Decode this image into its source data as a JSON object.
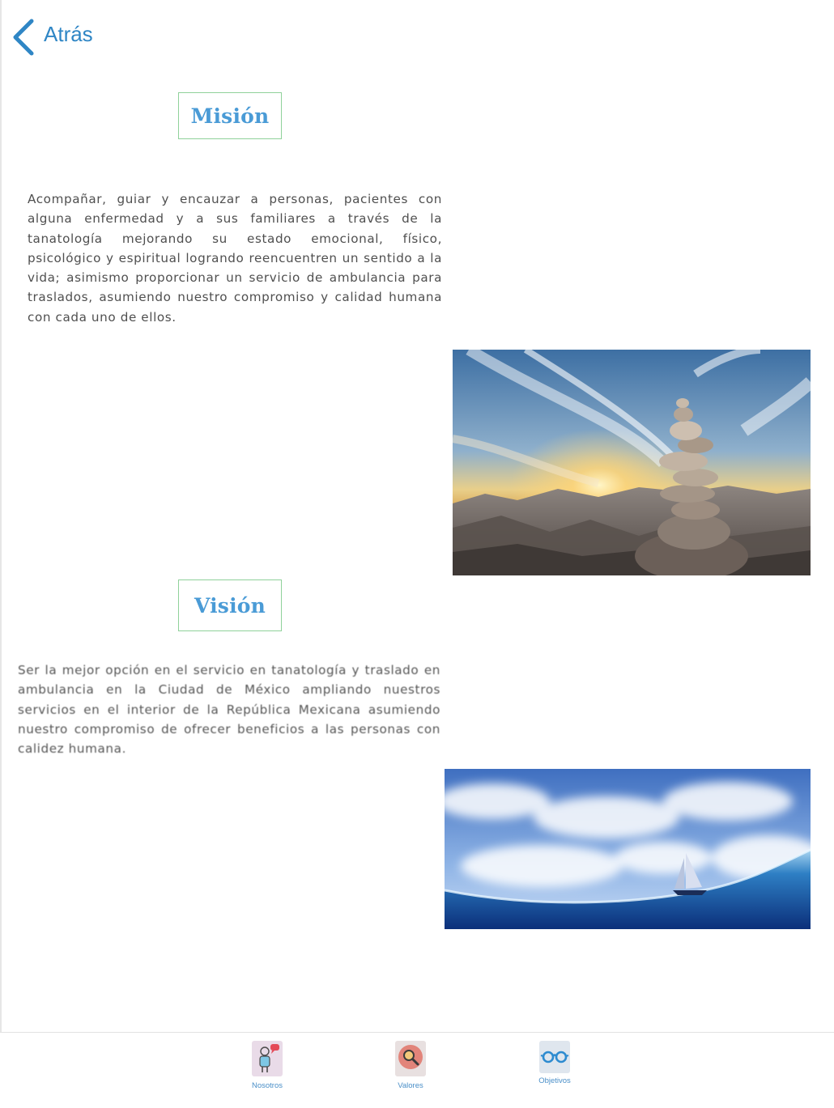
{
  "header": {
    "back_label": "Atrás"
  },
  "mision": {
    "title": "Misión",
    "text": "Acompañar, guiar y encauzar a personas, pacientes con alguna enfermedad y a sus familiares a través de la tanatología mejorando su estado emocional, físico, psicológico y espiritual logrando reencuentren un sentido a la vida; asimismo proporcionar un servicio de ambulancia para traslados, asumiendo nuestro compromiso y calidad humana con cada uno de ellos.",
    "image": "stacked-stones-sunset-image"
  },
  "vision": {
    "title": "Visión",
    "text": "Ser la mejor opción en el servicio en tanatología y traslado en ambulancia en la Ciudad de México ampliando nuestros servicios en el interior de la República Mexicana asumiendo nuestro compromiso de ofrecer beneficios a las personas con calidez humana.",
    "image": "sailboat-sky-wave-image"
  },
  "tabbar": {
    "tabs": [
      {
        "label": "Nosotros",
        "icon": "people-chat-icon"
      },
      {
        "label": "Valores",
        "icon": "magnifier-badge-icon"
      },
      {
        "label": "Objetivos",
        "icon": "glasses-icon"
      }
    ]
  },
  "colors": {
    "accent_blue": "#2f86c5",
    "heading_blue": "#4a9bd6",
    "heading_border": "#8fd19a",
    "body_text": "#4f4f4f",
    "tab_label": "#4a8fc8"
  }
}
